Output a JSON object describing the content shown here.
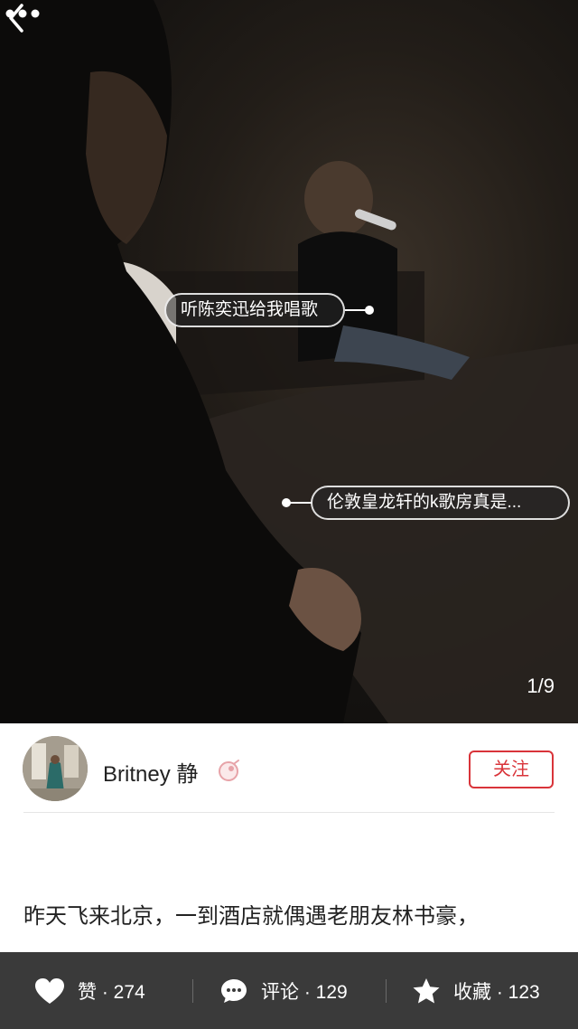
{
  "photo": {
    "tags": [
      {
        "text": "听陈奕迅给我唱歌"
      },
      {
        "text": "伦敦皇龙轩的k歌房真是..."
      }
    ],
    "counter": "1/9"
  },
  "nav": {
    "back_icon": "chevron-left-icon",
    "more_icon": "more-dots-icon"
  },
  "author": {
    "name": "Britney 静",
    "gender_icon": "female-icon",
    "follow_label": "关注"
  },
  "post": {
    "text": "昨天飞来北京，一到酒店就偶遇老朋友林书豪，"
  },
  "actions": {
    "like": {
      "label": "赞 · 274"
    },
    "comment": {
      "label": "评论 · 129"
    },
    "favorite": {
      "label": "收藏 · 123"
    }
  },
  "colors": {
    "accent": "#d9343a",
    "bar": "#3a3a3a"
  }
}
